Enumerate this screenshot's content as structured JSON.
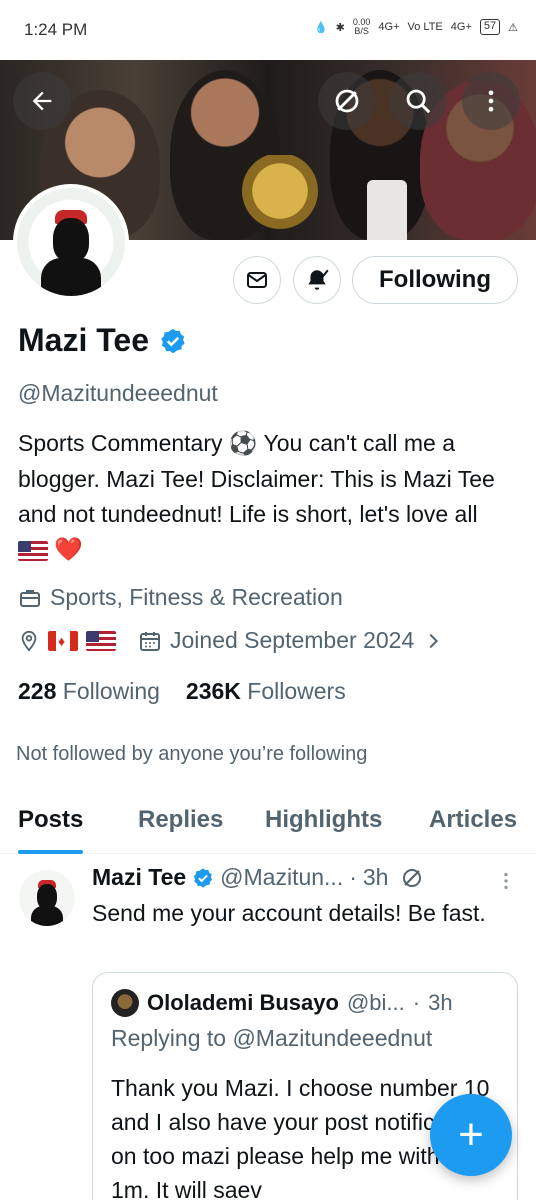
{
  "status_bar": {
    "time": "1:24 PM",
    "net_speed": "0.00",
    "net_unit": "B/S",
    "signal1": "4G+",
    "volte": "Vo LTE",
    "signal2": "4G+",
    "battery": "57"
  },
  "banner": {
    "icons": [
      "arrow-left-icon",
      "grok-icon",
      "search-icon",
      "more-vertical-icon"
    ]
  },
  "profile": {
    "name": "Mazi Tee",
    "verified": true,
    "handle": "@Mazitundeeednut",
    "bio_parts": [
      "Sports Commentary",
      "⚽",
      "You can't call me a blogger. Mazi Tee! Disclaimer: This is Mazi Tee and not tundeednut! Life is short, let's love all",
      "❤️"
    ],
    "category": "Sports, Fitness & Recreation",
    "joined": "Joined September 2024",
    "following_count": "228",
    "following_label": "Following",
    "followers_count": "236K",
    "followers_label": "Followers",
    "not_followed": "Not followed by anyone you’re following",
    "follow_button": "Following",
    "accent_color": "#1d9bf0"
  },
  "tabs": [
    {
      "label": "Posts",
      "active": true
    },
    {
      "label": "Replies",
      "active": false
    },
    {
      "label": "Highlights",
      "active": false
    },
    {
      "label": "Articles",
      "active": false
    }
  ],
  "post": {
    "name": "Mazi Tee",
    "handle": "@Mazitun...",
    "dot": "·",
    "time": "3h",
    "text": "Send me your account details! Be fast.",
    "quote": {
      "name": "Ololademi Busayo",
      "handle": "@bi...",
      "dot": "·",
      "time": "3h",
      "replying": "Replying to @Mazitundeeednut",
      "text": "Thank you Mazi. I choose number 10 and I also have your post notification on too mazi please help me with the 1m. It will saev"
    }
  },
  "fab": {
    "label": "+"
  }
}
